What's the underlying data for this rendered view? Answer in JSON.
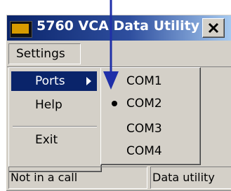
{
  "window": {
    "title": "5760 VCA Data Utility",
    "close_glyph": "✕"
  },
  "menubar": {
    "settings_label": "Settings"
  },
  "settings_menu": {
    "items": [
      {
        "label": "Ports",
        "has_submenu": true,
        "highlighted": true
      },
      {
        "label": "Help",
        "has_submenu": false,
        "highlighted": false
      },
      {
        "label": "Exit",
        "has_submenu": false,
        "highlighted": false
      }
    ]
  },
  "ports_submenu": {
    "items": [
      {
        "label": "COM1",
        "selected": false
      },
      {
        "label": "COM2",
        "selected": true
      },
      {
        "label": "COM3",
        "selected": false
      },
      {
        "label": "COM4",
        "selected": false
      }
    ]
  },
  "statusbar": {
    "call_status": "Not in a call",
    "app_status": "Data utility"
  },
  "colors": {
    "title_bar": "#0a246a",
    "highlight": "#0a246a",
    "annotation_arrow": "#1f2fa8",
    "face": "#d4d0c8"
  },
  "icons": {
    "app": "app-window-icon",
    "close": "close-icon",
    "submenu": "submenu-arrow-icon",
    "radio": "radio-dot-icon"
  }
}
